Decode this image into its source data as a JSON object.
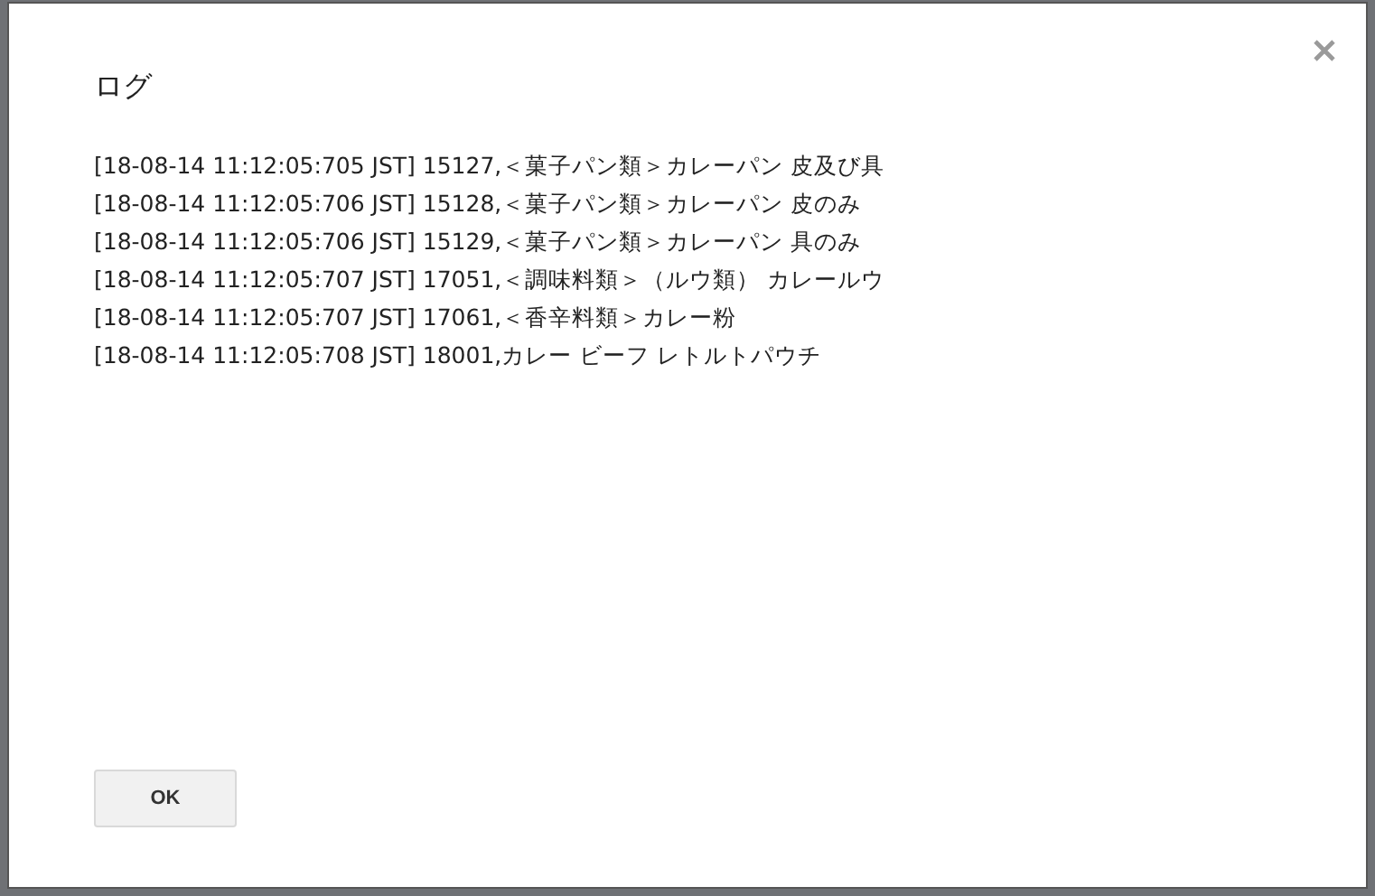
{
  "dialog": {
    "title": "ログ",
    "lines": [
      "[18-08-14 11:12:05:705 JST] 15127,＜菓子パン類＞カレーパン 皮及び具",
      "[18-08-14 11:12:05:706 JST] 15128,＜菓子パン類＞カレーパン 皮のみ",
      "[18-08-14 11:12:05:706 JST] 15129,＜菓子パン類＞カレーパン 具のみ",
      "[18-08-14 11:12:05:707 JST] 17051,＜調味料類＞（ルウ類） カレールウ",
      "[18-08-14 11:12:05:707 JST] 17061,＜香辛料類＞カレー粉",
      "[18-08-14 11:12:05:708 JST] 18001,カレー ビーフ レトルトパウチ"
    ],
    "buttons": [
      "OK"
    ]
  }
}
